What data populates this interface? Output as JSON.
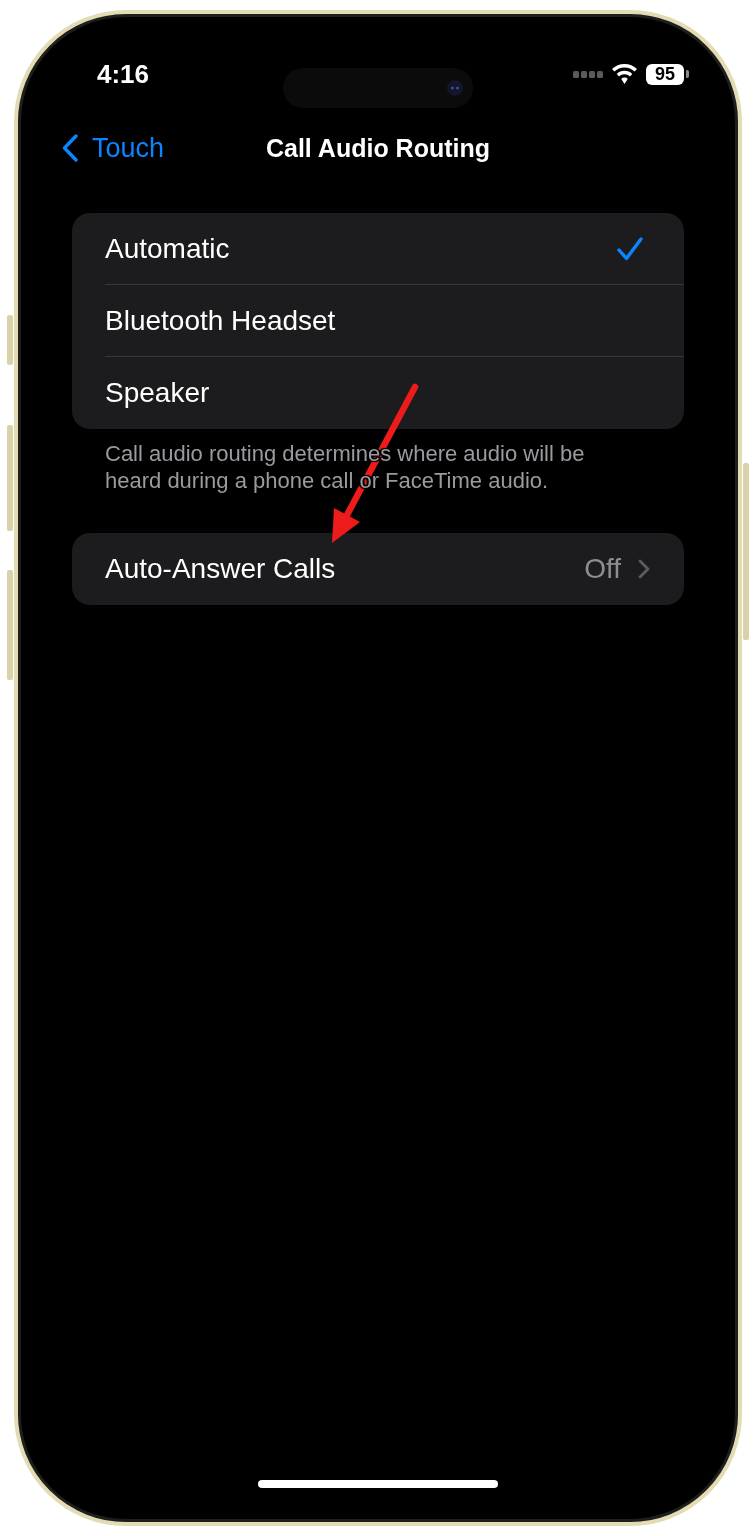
{
  "status_bar": {
    "time": "4:16",
    "battery": "95"
  },
  "nav_bar": {
    "back_label": "Touch",
    "title": "Call Audio Routing"
  },
  "routing_options": [
    {
      "label": "Automatic",
      "selected": true
    },
    {
      "label": "Bluetooth Headset",
      "selected": false
    },
    {
      "label": "Speaker",
      "selected": false
    }
  ],
  "routing_footer": "Call audio routing determines where audio will be heard during a phone call or FaceTime audio.",
  "auto_answer": {
    "label": "Auto-Answer Calls",
    "value": "Off"
  }
}
